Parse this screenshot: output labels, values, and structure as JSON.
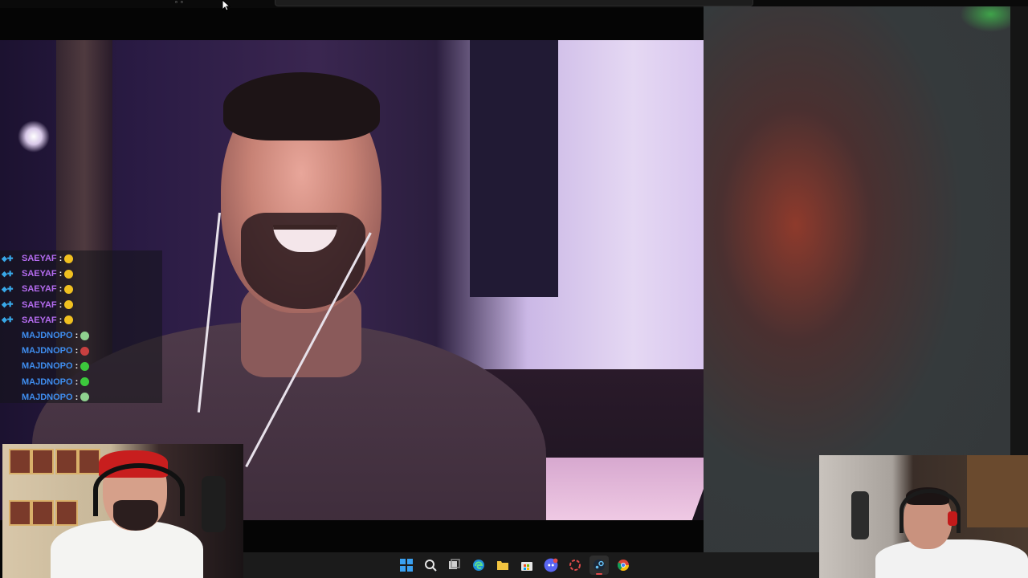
{
  "chat": {
    "separator": ":",
    "messages": [
      {
        "user": "SAEYAF",
        "color": "#b56cf0",
        "emote": "yellow-face-emote",
        "emote_color": "#f0c020"
      },
      {
        "user": "SAEYAF",
        "color": "#b56cf0",
        "emote": "yellow-face-emote",
        "emote_color": "#f0c020"
      },
      {
        "user": "SAEYAF",
        "color": "#b56cf0",
        "emote": "yellow-face-emote",
        "emote_color": "#f0c020"
      },
      {
        "user": "SAEYAF",
        "color": "#b56cf0",
        "emote": "yellow-face-emote",
        "emote_color": "#f0c020"
      },
      {
        "user": "SAEYAF",
        "color": "#b56cf0",
        "emote": "yellow-face-emote",
        "emote_color": "#f0c020"
      },
      {
        "user": "MAJDNOPO",
        "color": "#3f8ef0",
        "emote": "green-face-emote",
        "emote_color": "#8fd08f"
      },
      {
        "user": "MAJDNOPO",
        "color": "#3f8ef0",
        "emote": "red-emote",
        "emote_color": "#c84040"
      },
      {
        "user": "MAJDNOPO",
        "color": "#3f8ef0",
        "emote": "green-emote",
        "emote_color": "#3cc83c"
      },
      {
        "user": "MAJDNOPO",
        "color": "#3f8ef0",
        "emote": "green-emote",
        "emote_color": "#3cc83c"
      },
      {
        "user": "MAJDNOPO",
        "color": "#3f8ef0",
        "emote": "green-face-emote",
        "emote_color": "#8fd08f"
      }
    ]
  },
  "taskbar": {
    "icons": [
      "windows-start-icon",
      "search-icon",
      "task-view-icon",
      "edge-browser-icon",
      "file-explorer-icon",
      "microsoft-store-icon",
      "discord-icon",
      "app-icon",
      "steam-icon",
      "chrome-icon"
    ],
    "active": "steam-icon"
  },
  "colors": {
    "taskbar_bg": "#1b1b1b",
    "active_indicator": "#e14b4b",
    "saeyaf_name": "#b56cf0",
    "majdnopo_name": "#3f8ef0"
  }
}
